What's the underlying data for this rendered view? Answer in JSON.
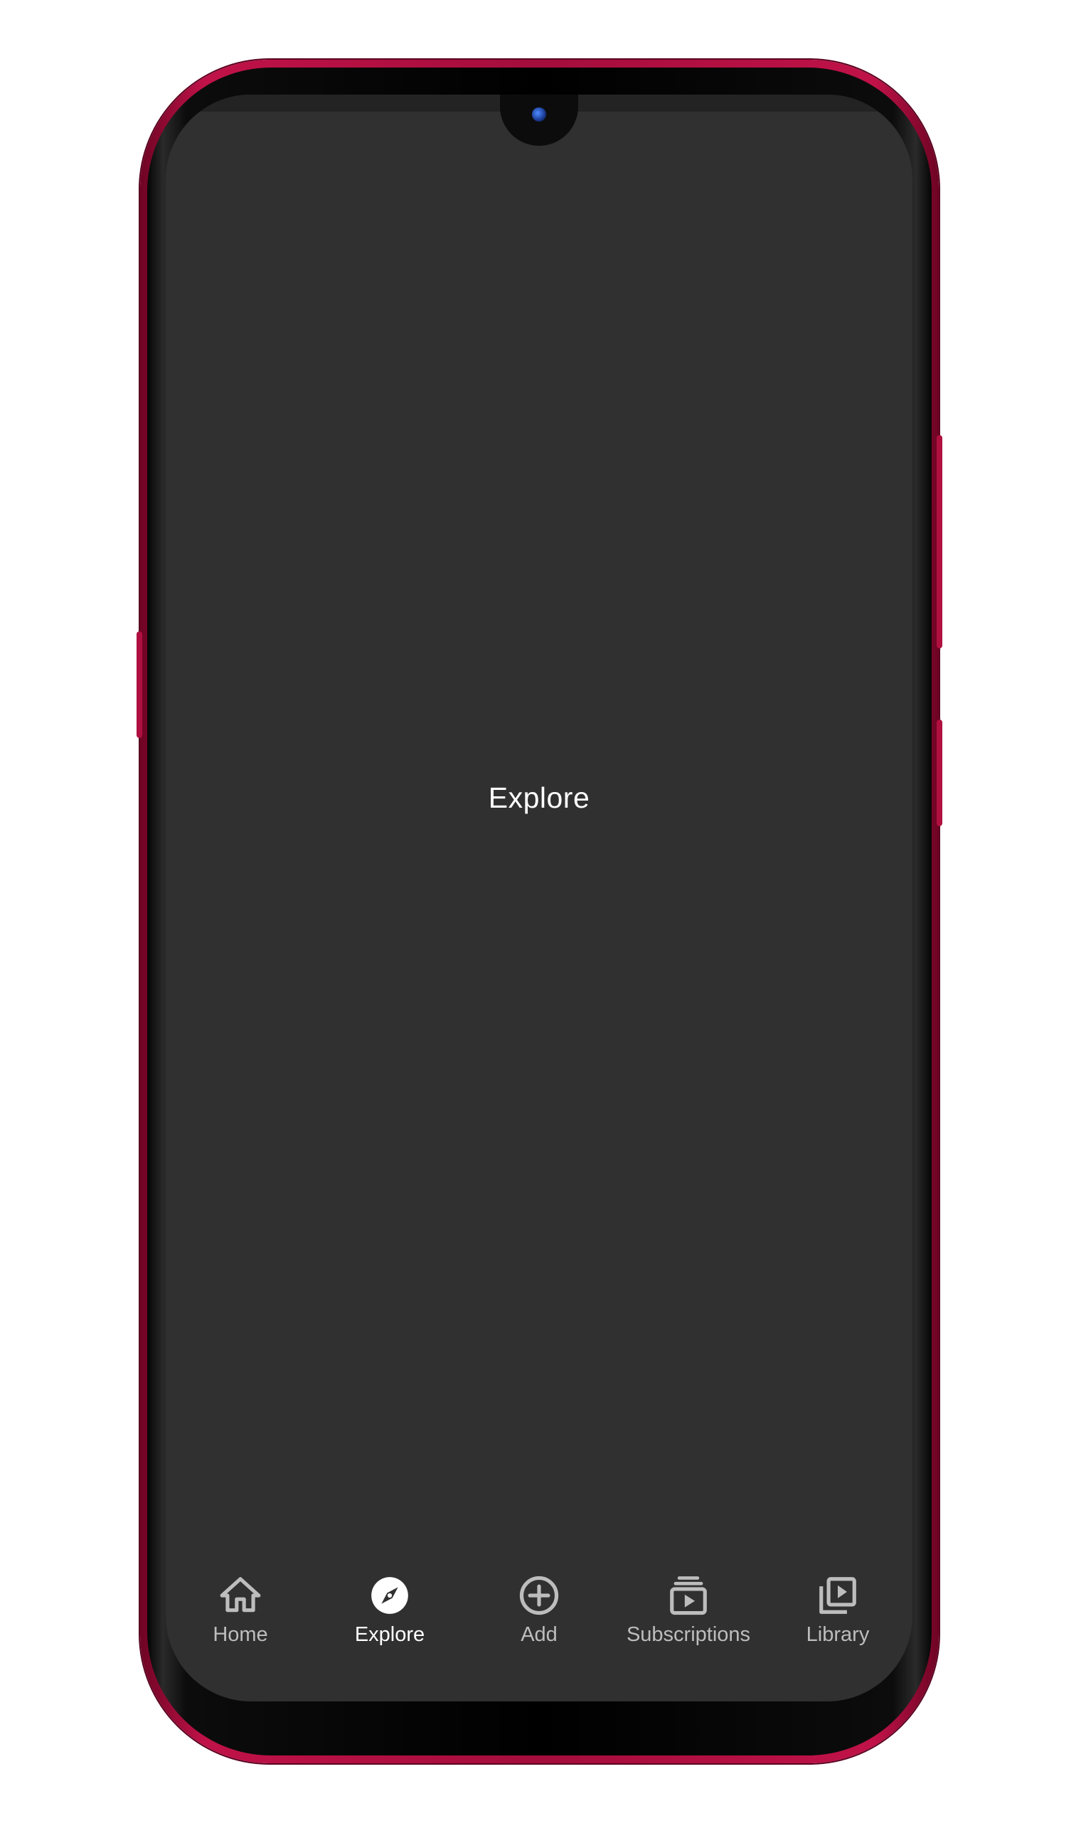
{
  "screen": {
    "content_label": "Explore",
    "background_color": "#303030"
  },
  "bottom_nav": {
    "selected": "Explore",
    "active_color": "#ffffff",
    "inactive_color": "#bdbdbd",
    "items": [
      {
        "label": "Home",
        "icon": "home-icon"
      },
      {
        "label": "Explore",
        "icon": "compass-icon"
      },
      {
        "label": "Add",
        "icon": "add-circle-icon"
      },
      {
        "label": "Subscriptions",
        "icon": "subscriptions-icon"
      },
      {
        "label": "Library",
        "icon": "video-library-icon"
      }
    ]
  },
  "device": {
    "frame_color": "#b0103f"
  }
}
